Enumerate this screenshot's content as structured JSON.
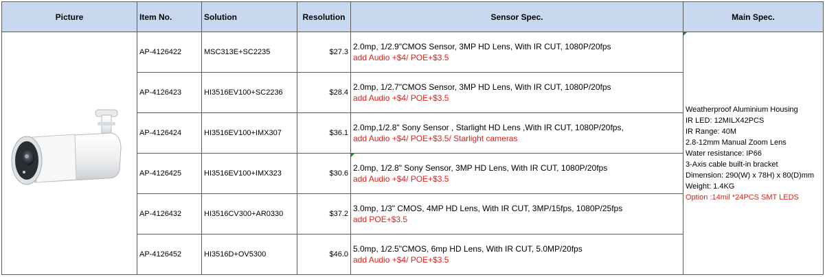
{
  "headers": {
    "picture": "Picture",
    "item_no": "Item No.",
    "solution": "Solution",
    "resolution": "Resolution",
    "sensor_spec": "Sensor Spec.",
    "main_spec": "Main Spec."
  },
  "rows": [
    {
      "item": "AP-4126422",
      "solution": "MSC313E+SC2235",
      "price": "$27.3",
      "sensor": "2.0mp, 1/2.9\"CMOS Sensor, 3MP HD Lens, With IR CUT, 1080P/20fps",
      "addon": "add Audio +$4/ POE+$3.5"
    },
    {
      "item": "AP-4126423",
      "solution": "HI3516EV100+SC2236",
      "price": "$28.4",
      "sensor": "2.0mp, 1/2.7\"CMOS Sensor, 3MP HD Lens, With IR CUT, 1080P/20fps",
      "addon": "add Audio +$4/ POE+$3.5"
    },
    {
      "item": "AP-4126424",
      "solution": "HI3516EV100+IMX307",
      "price": "$36.1",
      "sensor": "2.0mp,1/2.8\" Sony Sensor , Starlight HD Lens ,With IR CUT, 1080P/20fps,",
      "addon": "add Audio +$4/ POE+$3.5/ Starlight cameras"
    },
    {
      "item": "AP-4126425",
      "solution": "HI3516EV100+IMX323",
      "price": "$30.6",
      "sensor": "2.0mp, 1/2.8\" Sony Sensor, 3MP HD Lens, With IR CUT, 1080P/20fps",
      "addon": "add Audio +$4/ POE+$3.5"
    },
    {
      "item": "AP-4126432",
      "solution": "HI3516CV300+AR0330",
      "price": "$37.2",
      "sensor": "3.0mp, 1/3\" CMOS, 4MP  HD Lens, With IR CUT, 3MP/15fps, 1080P/25fps",
      "addon": "add POE+$3.5"
    },
    {
      "item": "AP-4126452",
      "solution": "HI3516D+OV5300",
      "price": "$46.0",
      "sensor": "5.0mp, 1/2.5\"CMOS, 6mp HD Lens, With IR CUT,  5.0MP/20fps",
      "addon": "add Audio +$4/ POE+$3.5"
    }
  ],
  "main_spec": [
    "Weatherproof Aluminium Housing",
    "IR LED: 12MILX42PCS",
    "IR Range: 40M",
    "2.8-12mm Manual Zoom Lens",
    "Water resistance: IP66",
    "3-Axis cable built-in bracket",
    "Dimension: 290(W) x 78H) x 80(D)mm",
    "Weight: 1.4KG"
  ],
  "main_spec_option": "Option :14mil *24PCS SMT LEDS",
  "colors": {
    "header_bg": "#c7d8ef",
    "addon_red": "#e0201b",
    "border": "#5a5a5a"
  }
}
